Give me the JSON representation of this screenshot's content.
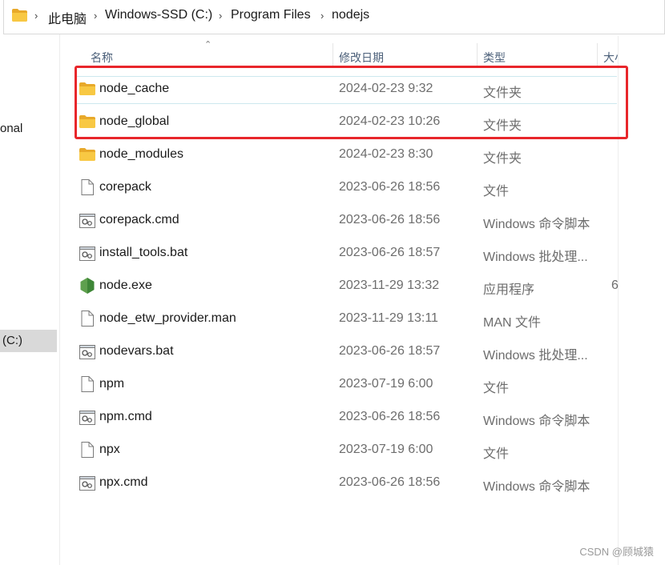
{
  "address_bar": {
    "crumbs": [
      "此电脑",
      "Windows-SSD (C:)",
      "Program Files",
      "nodejs"
    ]
  },
  "nav_pane": {
    "item_partial_top": "onal",
    "item_drive": "(C:)"
  },
  "columns": {
    "name": "名称",
    "date": "修改日期",
    "type": "类型",
    "size": "大小"
  },
  "files": [
    {
      "name": "node_cache",
      "date": "2024-02-23 9:32",
      "type": "文件夹",
      "size": "",
      "icon": "folder-icon"
    },
    {
      "name": "node_global",
      "date": "2024-02-23 10:26",
      "type": "文件夹",
      "size": "",
      "icon": "folder-icon"
    },
    {
      "name": "node_modules",
      "date": "2024-02-23 8:30",
      "type": "文件夹",
      "size": "",
      "icon": "folder-icon"
    },
    {
      "name": "corepack",
      "date": "2023-06-26 18:56",
      "type": "文件",
      "size": "",
      "icon": "file-icon"
    },
    {
      "name": "corepack.cmd",
      "date": "2023-06-26 18:56",
      "type": "Windows 命令脚本",
      "size": "",
      "icon": "script-icon"
    },
    {
      "name": "install_tools.bat",
      "date": "2023-06-26 18:57",
      "type": "Windows 批处理...",
      "size": "",
      "icon": "script-icon"
    },
    {
      "name": "node.exe",
      "date": "2023-11-29 13:32",
      "type": "应用程序",
      "size": "6",
      "icon": "nodejs-icon"
    },
    {
      "name": "node_etw_provider.man",
      "date": "2023-11-29 13:11",
      "type": "MAN 文件",
      "size": "",
      "icon": "file-icon"
    },
    {
      "name": "nodevars.bat",
      "date": "2023-06-26 18:57",
      "type": "Windows 批处理...",
      "size": "",
      "icon": "script-icon"
    },
    {
      "name": "npm",
      "date": "2023-07-19 6:00",
      "type": "文件",
      "size": "",
      "icon": "file-icon"
    },
    {
      "name": "npm.cmd",
      "date": "2023-06-26 18:56",
      "type": "Windows 命令脚本",
      "size": "",
      "icon": "script-icon"
    },
    {
      "name": "npx",
      "date": "2023-07-19 6:00",
      "type": "文件",
      "size": "",
      "icon": "file-icon"
    },
    {
      "name": "npx.cmd",
      "date": "2023-06-26 18:56",
      "type": "Windows 命令脚本",
      "size": "",
      "icon": "script-icon"
    }
  ],
  "watermark": "CSDN @顾城猿",
  "colors": {
    "highlight": "#e8262b",
    "folder": "#f8c843",
    "node_green": "#5fa04e"
  }
}
